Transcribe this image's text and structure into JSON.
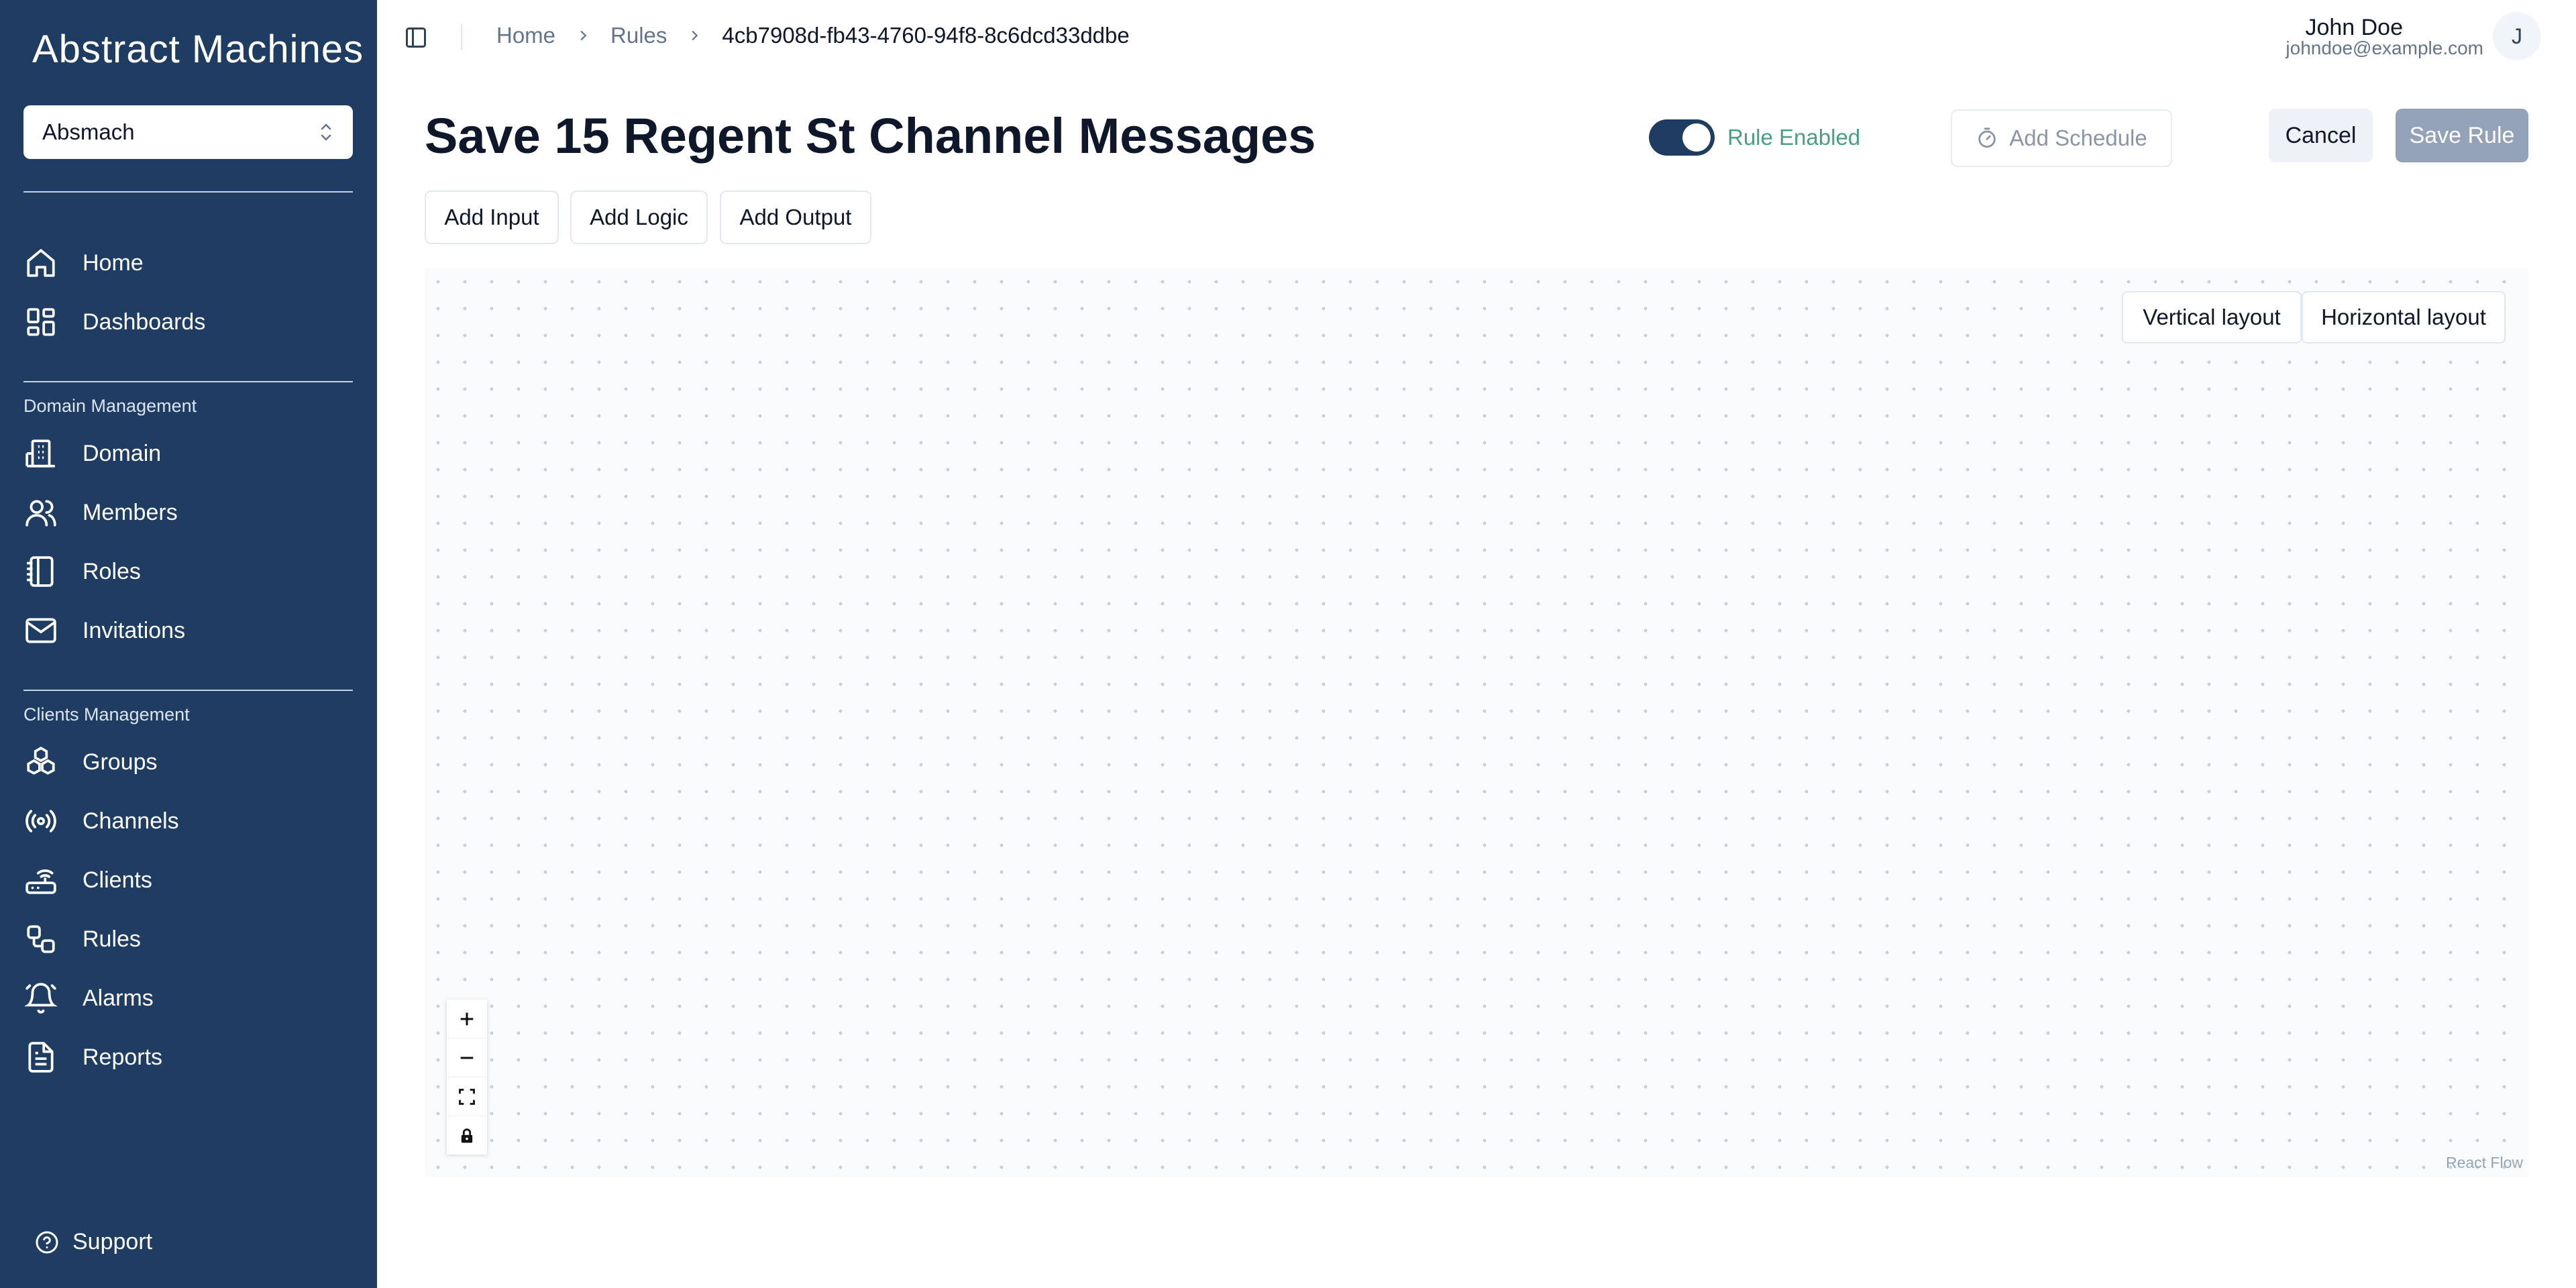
{
  "sidebar": {
    "logo": "Abstract Machines",
    "domain_selector": "Absmach",
    "primary": [
      {
        "label": "Home",
        "icon": "home-icon"
      },
      {
        "label": "Dashboards",
        "icon": "dashboard-icon"
      }
    ],
    "sections": [
      {
        "title": "Domain Management",
        "items": [
          {
            "label": "Domain",
            "icon": "building-icon"
          },
          {
            "label": "Members",
            "icon": "users-icon"
          },
          {
            "label": "Roles",
            "icon": "notebook-icon"
          },
          {
            "label": "Invitations",
            "icon": "mail-icon"
          }
        ]
      },
      {
        "title": "Clients Management",
        "items": [
          {
            "label": "Groups",
            "icon": "boxes-icon"
          },
          {
            "label": "Channels",
            "icon": "radio-icon"
          },
          {
            "label": "Clients",
            "icon": "router-icon"
          },
          {
            "label": "Rules",
            "icon": "workflow-icon"
          },
          {
            "label": "Alarms",
            "icon": "bell-icon"
          },
          {
            "label": "Reports",
            "icon": "file-text-icon"
          }
        ]
      }
    ],
    "support": "Support"
  },
  "topbar": {
    "breadcrumb": [
      "Home",
      "Rules",
      "4cb7908d-fb43-4760-94f8-8c6dcd33ddbe"
    ],
    "user": {
      "name": "John Doe",
      "email": "johndoe@example.com",
      "initial": "J"
    }
  },
  "header": {
    "title": "Save 15 Regent St Channel Messages",
    "toggle_label": "Rule Enabled",
    "toggle_on": true,
    "schedule_label": "Add Schedule",
    "cancel_label": "Cancel",
    "save_label": "Save Rule"
  },
  "toolbar": {
    "add_input": "Add Input",
    "add_logic": "Add Logic",
    "add_output": "Add Output"
  },
  "canvas": {
    "vertical_layout": "Vertical layout",
    "horizontal_layout": "Horizontal layout",
    "attribution": "React Flow",
    "controls": [
      "zoom-in-icon",
      "zoom-out-icon",
      "fit-view-icon",
      "lock-icon"
    ]
  },
  "colors": {
    "sidebar_bg": "#1f3d63",
    "toggle_on": "#1f3d63",
    "toggle_label": "#4a9e84",
    "save_disabled": "#93a2b8"
  }
}
